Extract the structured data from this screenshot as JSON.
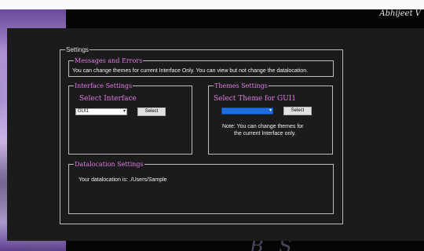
{
  "window": {
    "brand_top": "Abhijeet V",
    "brand_bottom": "B     S"
  },
  "settings": {
    "legend": "Settings",
    "messages": {
      "legend": "Messages and Errors",
      "text": "You can change themes for current Interface Only. You can view but not change the datalocation."
    },
    "interface": {
      "legend": "Interface Settings",
      "heading": "Select Interface",
      "selected": "GUI1",
      "button": "Select"
    },
    "themes": {
      "legend": "Themes Settings",
      "heading": "Select Theme for GUI1",
      "selected": "",
      "button": "Select",
      "note_line1": "Note: You can change themes for",
      "note_line2": "the current Interface only."
    },
    "datalocation": {
      "legend": "Datalocation Settings",
      "text": "Your datalocation is: ./Users/Sample"
    }
  },
  "colors": {
    "accent_pink": "#e07ae6",
    "panel_bg": "#1b1b1b",
    "selection_blue": "#1e6fd9"
  }
}
